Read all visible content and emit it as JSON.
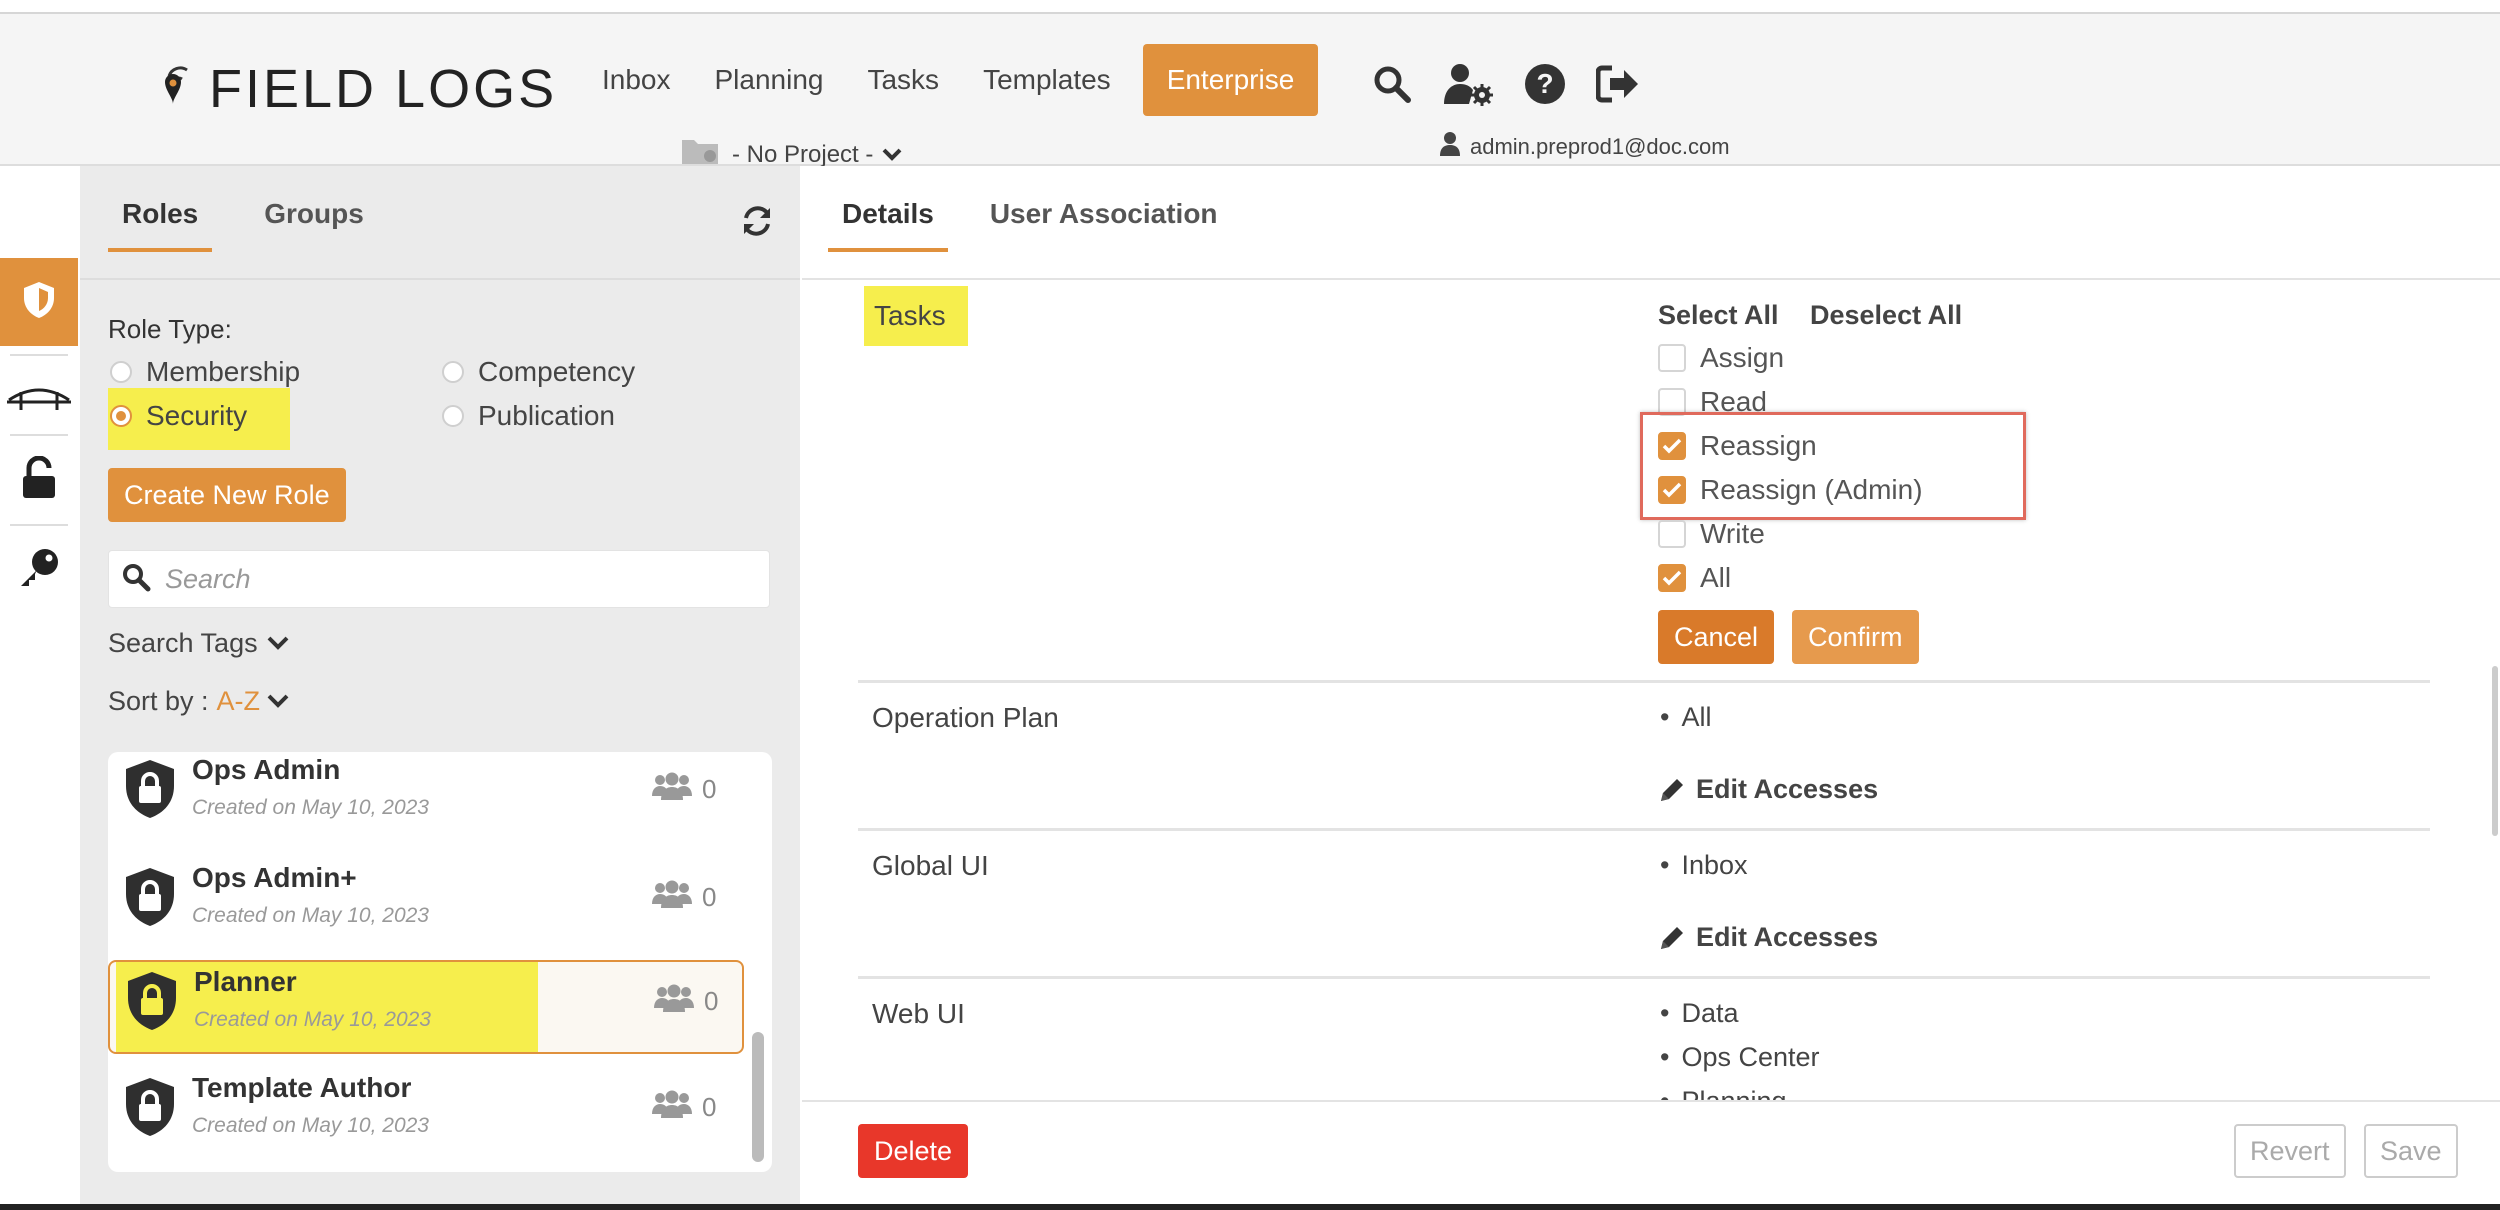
{
  "app": {
    "logo_text": "FIELD LOGS"
  },
  "nav": {
    "items": [
      {
        "label": "Inbox"
      },
      {
        "label": "Planning"
      },
      {
        "label": "Tasks"
      },
      {
        "label": "Templates"
      },
      {
        "label": "Enterprise"
      }
    ],
    "project_label": "- No Project -",
    "user_email": "admin.preprod1@doc.com"
  },
  "left": {
    "tabs": [
      {
        "label": "Roles"
      },
      {
        "label": "Groups"
      }
    ],
    "role_type_label": "Role Type:",
    "role_types": [
      {
        "label": "Membership",
        "checked": false
      },
      {
        "label": "Competency",
        "checked": false
      },
      {
        "label": "Security",
        "checked": true
      },
      {
        "label": "Publication",
        "checked": false
      }
    ],
    "create_button": "Create New Role",
    "search_placeholder": "Search",
    "search_tags_label": "Search Tags",
    "sort_label": "Sort by :",
    "sort_value": "A-Z",
    "roles": [
      {
        "name": "Ops Admin",
        "created": "Created on May 10, 2023",
        "users": "0"
      },
      {
        "name": "Ops Admin+",
        "created": "Created on May 10, 2023",
        "users": "0"
      },
      {
        "name": "Planner",
        "created": "Created on May 10, 2023",
        "users": "0"
      },
      {
        "name": "Template Author",
        "created": "Created on May 10, 2023",
        "users": "0"
      }
    ]
  },
  "right": {
    "tabs": [
      {
        "label": "Details"
      },
      {
        "label": "User Association"
      }
    ],
    "tasks_label": "Tasks",
    "select_all": "Select All",
    "deselect_all": "Deselect All",
    "task_permissions": [
      {
        "label": "Assign",
        "checked": false
      },
      {
        "label": "Read",
        "checked": false
      },
      {
        "label": "Reassign",
        "checked": true
      },
      {
        "label": "Reassign (Admin)",
        "checked": true
      },
      {
        "label": "Write",
        "checked": false
      },
      {
        "label": "All",
        "checked": true
      }
    ],
    "cancel": "Cancel",
    "confirm": "Confirm",
    "sections": [
      {
        "label": "Operation Plan",
        "values": [
          "All"
        ],
        "edit_label": "Edit Accesses"
      },
      {
        "label": "Global UI",
        "values": [
          "Inbox"
        ],
        "edit_label": "Edit Accesses"
      },
      {
        "label": "Web UI",
        "values": [
          "Data",
          "Ops Center",
          "Planning"
        ]
      }
    ],
    "delete": "Delete",
    "revert": "Revert",
    "save": "Save"
  },
  "colors": {
    "accent": "#e0913d",
    "highlight": "#f6ee4d",
    "danger": "#e8372a",
    "annotation_box": "#e06a5c"
  },
  "icons": [
    "logo-pin-icon",
    "search-icon",
    "user-settings-icon",
    "help-icon",
    "logout-icon",
    "folder-icon",
    "chevron-down-icon",
    "user-icon",
    "shield-icon",
    "bridge-icon",
    "unlock-icon",
    "key-icon",
    "refresh-icon",
    "lock-shield-icon",
    "users-icon",
    "pencil-icon",
    "check-icon"
  ]
}
